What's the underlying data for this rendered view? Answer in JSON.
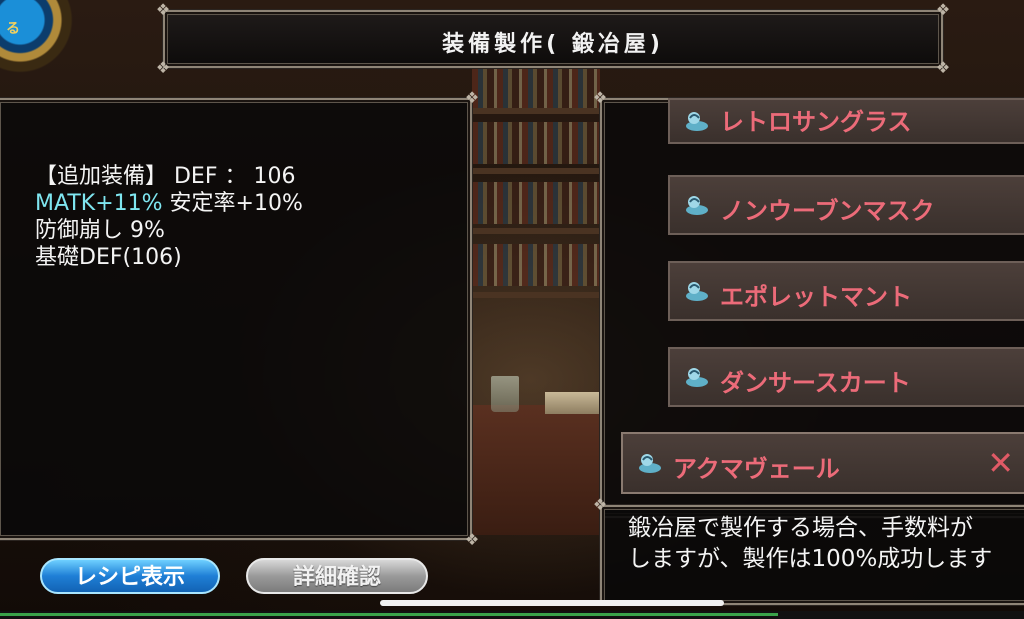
{
  "header": {
    "title": "装備製作( 鍛冶屋)"
  },
  "ring": {
    "label": "る"
  },
  "info": {
    "line1": "【追加装備】 DEF ： 106",
    "line2_cyan": "MATK+11%",
    "line2_rest": " 安定率+10%",
    "line3": "防御崩し 9%",
    "line4": "基礎DEF(106)"
  },
  "list": {
    "items": [
      {
        "label": "レトロサングラス",
        "icon": "wand-icon"
      },
      {
        "label": "ノンウーブンマスク",
        "icon": "wand-icon"
      },
      {
        "label": "エポレットマント",
        "icon": "wand-icon"
      },
      {
        "label": "ダンサースカート",
        "icon": "wand-icon"
      },
      {
        "label": "アクマヴェール",
        "icon": "wand-icon",
        "selected": true,
        "close": "✕"
      }
    ]
  },
  "description": {
    "line1": "鍛冶屋で製作する場合、手数料が",
    "line2": "しますが、製作は100%成功します"
  },
  "buttons": {
    "recipe": "レシピ表示",
    "details": "詳細確認"
  },
  "progress": {
    "value": 0.76
  },
  "colors": {
    "item_text": "#ec6b79",
    "cyan": "#7fe6f0",
    "blue_button": "#1f7fd6"
  }
}
